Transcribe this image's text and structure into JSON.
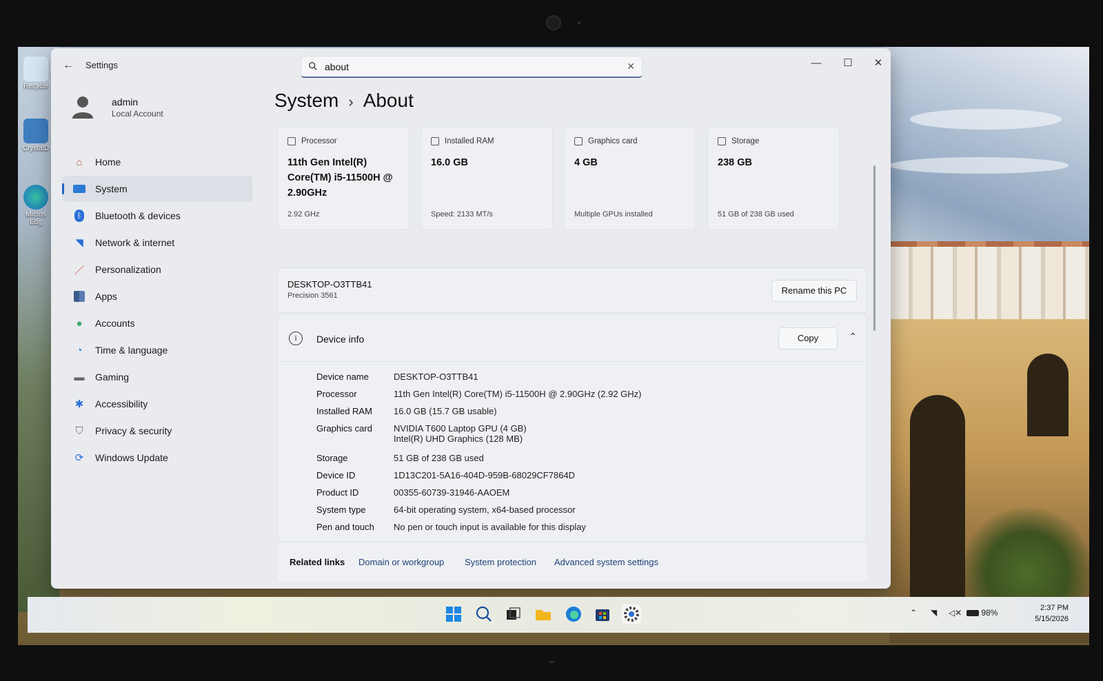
{
  "window": {
    "app_title": "Settings",
    "search": {
      "value": "about"
    }
  },
  "profile": {
    "name": "admin",
    "role": "Local Account"
  },
  "sidebar": {
    "items": [
      {
        "label": "Home",
        "icon": "home-icon"
      },
      {
        "label": "System",
        "icon": "system-icon",
        "active": true
      },
      {
        "label": "Bluetooth & devices",
        "icon": "bluetooth-icon"
      },
      {
        "label": "Network & internet",
        "icon": "wifi-icon"
      },
      {
        "label": "Personalization",
        "icon": "brush-icon"
      },
      {
        "label": "Apps",
        "icon": "apps-icon"
      },
      {
        "label": "Accounts",
        "icon": "person-icon"
      },
      {
        "label": "Time & language",
        "icon": "globe-clock-icon"
      },
      {
        "label": "Gaming",
        "icon": "gamepad-icon"
      },
      {
        "label": "Accessibility",
        "icon": "accessibility-icon"
      },
      {
        "label": "Privacy & security",
        "icon": "shield-icon"
      },
      {
        "label": "Windows Update",
        "icon": "update-icon"
      }
    ]
  },
  "breadcrumb": {
    "parent": "System",
    "current": "About"
  },
  "cards": [
    {
      "title": "Processor",
      "value": "11th Gen Intel(R) Core(TM) i5-11500H @ 2.90GHz",
      "sub": "2.92 GHz"
    },
    {
      "title": "Installed RAM",
      "value": "16.0 GB",
      "sub": "Speed: 2133 MT/s"
    },
    {
      "title": "Graphics card",
      "value": "4 GB",
      "sub": "Multiple GPUs installed"
    },
    {
      "title": "Storage",
      "value": "238 GB",
      "sub": "51 GB of 238 GB used"
    }
  ],
  "pc": {
    "name": "DESKTOP-O3TTB41",
    "model": "Precision 3561",
    "rename_label": "Rename this PC"
  },
  "device_info": {
    "title": "Device info",
    "copy_label": "Copy",
    "specs": [
      {
        "label": "Device name",
        "value": "DESKTOP-O3TTB41"
      },
      {
        "label": "Processor",
        "value": "11th Gen Intel(R) Core(TM) i5-11500H @ 2.90GHz (2.92 GHz)"
      },
      {
        "label": "Installed RAM",
        "value": "16.0 GB (15.7 GB usable)"
      },
      {
        "label": "Graphics card",
        "value": "NVIDIA T600 Laptop GPU (4 GB)",
        "value2": "Intel(R) UHD Graphics (128 MB)"
      },
      {
        "label": "Storage",
        "value": "51 GB of 238 GB used"
      },
      {
        "label": "Device ID",
        "value": "1D13C201-5A16-404D-959B-68029CF7864D"
      },
      {
        "label": "Product ID",
        "value": "00355-60739-31946-AAOEM"
      },
      {
        "label": "System type",
        "value": "64-bit operating system, x64-based processor"
      },
      {
        "label": "Pen and touch",
        "value": "No pen or touch input is available for this display"
      }
    ]
  },
  "related_links": {
    "title": "Related links",
    "links": [
      "Domain or workgroup",
      "System protection",
      "Advanced system settings"
    ]
  },
  "desktop_icons": [
    "Recycle",
    "CrystalD",
    "Micros Edg"
  ],
  "taskbar": {
    "battery": "98%",
    "time": "2:37 PM",
    "date": "5/15/2026"
  },
  "colors": {
    "accent": "#2463c9",
    "window_bg": "#e9ebef",
    "card_bg": "#eef0f3"
  }
}
